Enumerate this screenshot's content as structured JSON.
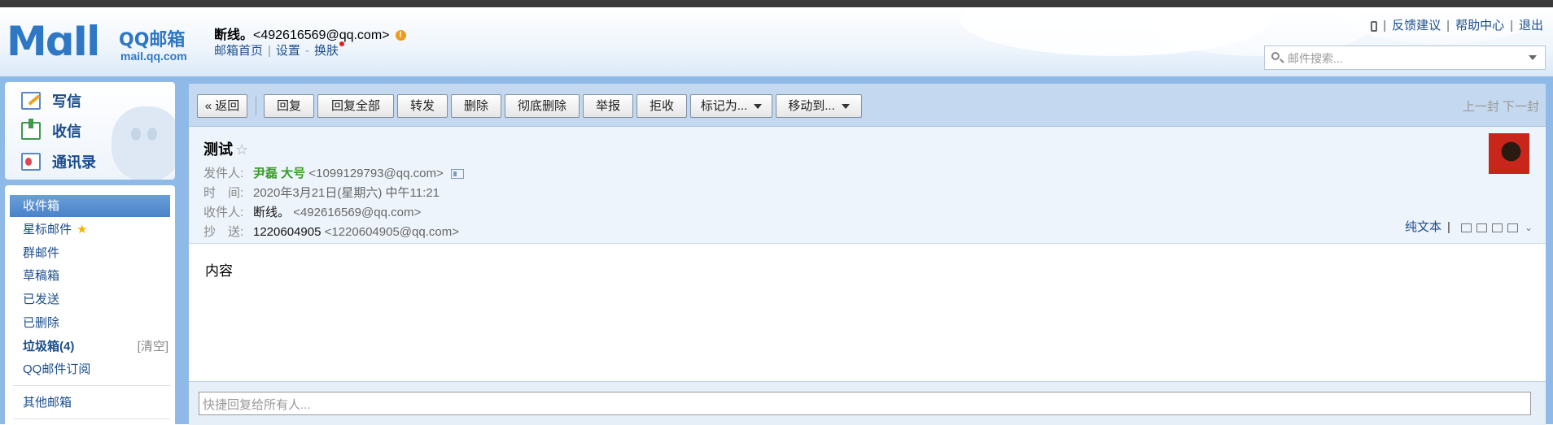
{
  "header": {
    "logo_word": "MɑIl",
    "logo_title": "QQ邮箱",
    "logo_domain": "mail.qq.com",
    "user_name": "断线。",
    "user_email": "<492616569@qq.com>",
    "warn_glyph": "!",
    "links": {
      "home": "邮箱首页",
      "settings": "设置",
      "dash": "-",
      "skin": "换肤"
    },
    "top_links": {
      "feedback": "反馈建议",
      "help": "帮助中心",
      "logout": "退出"
    },
    "search_placeholder": "邮件搜索..."
  },
  "sidebar": {
    "compose": "写信",
    "receive": "收信",
    "contacts": "通讯录",
    "folders": {
      "inbox": "收件箱",
      "starred": "星标邮件",
      "group": "群邮件",
      "drafts": "草稿箱",
      "sent": "已发送",
      "deleted": "已删除",
      "spam": "垃圾箱(4)",
      "spam_clear": "[清空]",
      "subscription": "QQ邮件订阅",
      "other": "其他邮箱"
    }
  },
  "toolbar": {
    "back": "« 返回",
    "reply": "回复",
    "reply_all": "回复全部",
    "forward": "转发",
    "delete": "删除",
    "delete_forever": "彻底删除",
    "report": "举报",
    "reject": "拒收",
    "mark_as": "标记为...",
    "move_to": "移动到...",
    "prev_next": "上一封 下一封"
  },
  "mail": {
    "subject": "测试",
    "from_label": "发件人:",
    "from_name": "尹磊 大号",
    "from_email": "<1099129793@qq.com>",
    "time_label": "时　间:",
    "time_value": "2020年3月21日(星期六) 中午11:21",
    "to_label": "收件人:",
    "to_name": "断线。",
    "to_email": "<492616569@qq.com>",
    "cc_label": "抄　送:",
    "cc_name": "1220604905",
    "cc_email": "<1220604905@qq.com>",
    "plain_text": "纯文本",
    "body": "内容"
  },
  "reply": {
    "placeholder": "快捷回复给所有人..."
  },
  "colors": {
    "accent": "#2e77c5",
    "frame": "#8fb9e6",
    "toolbar": "#c4d8ef",
    "sender_name": "#3a9a2a",
    "active_folder": "#4a82c8"
  }
}
